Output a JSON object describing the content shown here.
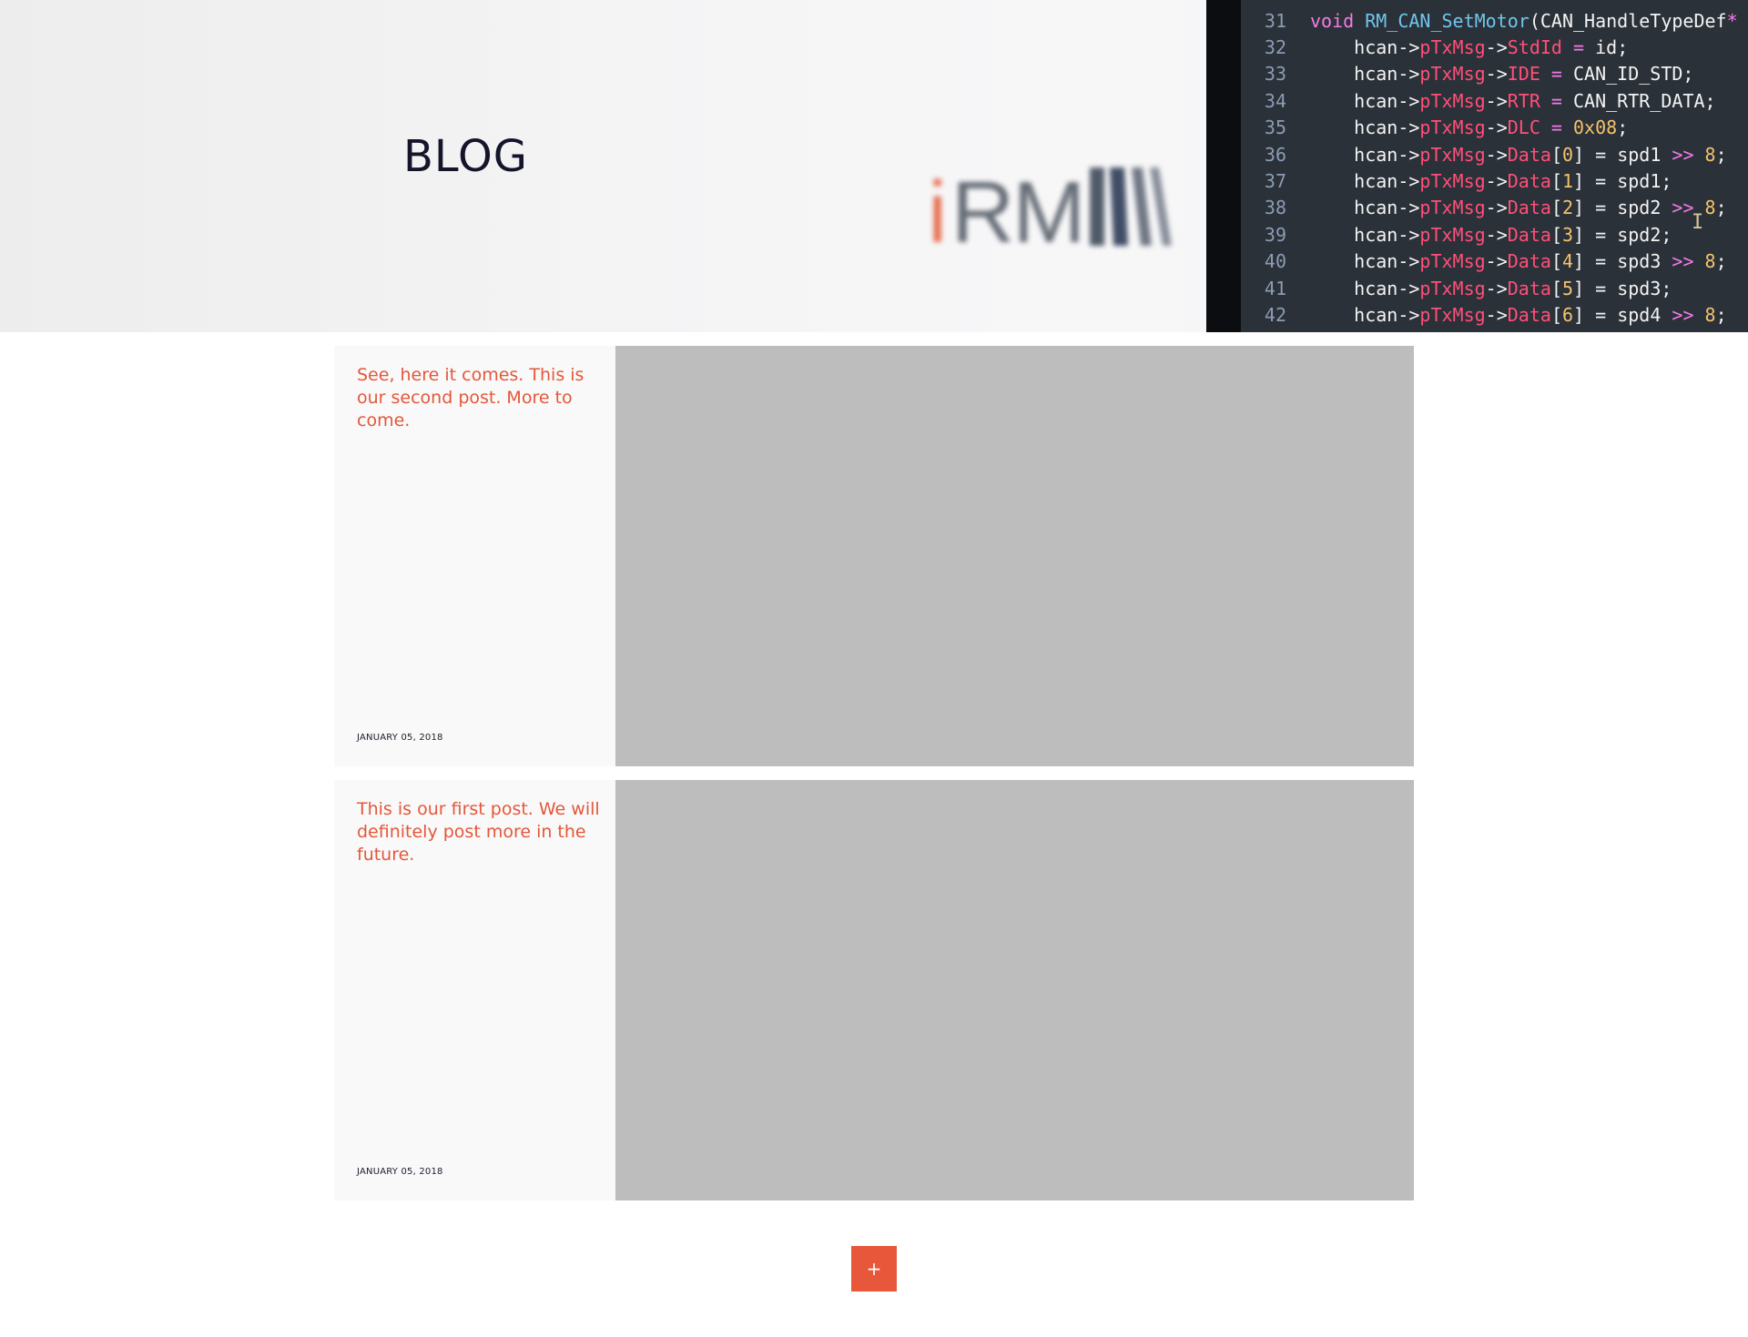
{
  "hero": {
    "title": "BLOG",
    "logo": {
      "i_text": "i",
      "rm_text": "RM",
      "bar_colors": [
        "#404a5a",
        "#2d3b57",
        "#626a78",
        "#7c8390"
      ]
    },
    "code": [
      {
        "n": "31",
        "tokens": [
          {
            "t": "void ",
            "c": "k"
          },
          {
            "t": "RM_CAN_SetMotor",
            "c": "fn"
          },
          {
            "t": "(CAN_HandleTypeDef",
            "c": ""
          },
          {
            "t": "*",
            "c": "k"
          }
        ]
      },
      {
        "n": "32",
        "tokens": [
          {
            "t": "    hcan->",
            "c": ""
          },
          {
            "t": "pTxMsg",
            "c": "pr"
          },
          {
            "t": "->",
            "c": ""
          },
          {
            "t": "StdId",
            "c": "pr"
          },
          {
            "t": " = ",
            "c": "op"
          },
          {
            "t": "id;",
            "c": ""
          }
        ]
      },
      {
        "n": "33",
        "tokens": [
          {
            "t": "    hcan->",
            "c": ""
          },
          {
            "t": "pTxMsg",
            "c": "pr"
          },
          {
            "t": "->",
            "c": ""
          },
          {
            "t": "IDE",
            "c": "pr"
          },
          {
            "t": " = ",
            "c": "op"
          },
          {
            "t": "CAN_ID_STD;",
            "c": ""
          }
        ]
      },
      {
        "n": "34",
        "tokens": [
          {
            "t": "    hcan->",
            "c": ""
          },
          {
            "t": "pTxMsg",
            "c": "pr"
          },
          {
            "t": "->",
            "c": ""
          },
          {
            "t": "RTR",
            "c": "pr"
          },
          {
            "t": " = ",
            "c": "op"
          },
          {
            "t": "CAN_RTR_DATA;",
            "c": ""
          }
        ]
      },
      {
        "n": "35",
        "tokens": [
          {
            "t": "    hcan->",
            "c": ""
          },
          {
            "t": "pTxMsg",
            "c": "pr"
          },
          {
            "t": "->",
            "c": ""
          },
          {
            "t": "DLC",
            "c": "pr"
          },
          {
            "t": " = ",
            "c": "op"
          },
          {
            "t": "0x08",
            "c": "nm"
          },
          {
            "t": ";",
            "c": ""
          }
        ]
      },
      {
        "n": "36",
        "tokens": [
          {
            "t": "    hcan->",
            "c": ""
          },
          {
            "t": "pTxMsg",
            "c": "pr"
          },
          {
            "t": "->",
            "c": ""
          },
          {
            "t": "Data",
            "c": "pr"
          },
          {
            "t": "[",
            "c": ""
          },
          {
            "t": "0",
            "c": "nm"
          },
          {
            "t": "] = spd1 ",
            "c": ""
          },
          {
            "t": ">>",
            "c": "op"
          },
          {
            "t": " 8",
            "c": "nm"
          },
          {
            "t": ";",
            "c": ""
          }
        ]
      },
      {
        "n": "37",
        "tokens": [
          {
            "t": "    hcan->",
            "c": ""
          },
          {
            "t": "pTxMsg",
            "c": "pr"
          },
          {
            "t": "->",
            "c": ""
          },
          {
            "t": "Data",
            "c": "pr"
          },
          {
            "t": "[",
            "c": ""
          },
          {
            "t": "1",
            "c": "nm"
          },
          {
            "t": "] = spd1;",
            "c": ""
          }
        ]
      },
      {
        "n": "38",
        "tokens": [
          {
            "t": "    hcan->",
            "c": ""
          },
          {
            "t": "pTxMsg",
            "c": "pr"
          },
          {
            "t": "->",
            "c": ""
          },
          {
            "t": "Data",
            "c": "pr"
          },
          {
            "t": "[",
            "c": ""
          },
          {
            "t": "2",
            "c": "nm"
          },
          {
            "t": "] = spd2 ",
            "c": ""
          },
          {
            "t": ">>",
            "c": "op"
          },
          {
            "t": " 8",
            "c": "nm"
          },
          {
            "t": ";",
            "c": ""
          }
        ]
      },
      {
        "n": "39",
        "tokens": [
          {
            "t": "    hcan->",
            "c": ""
          },
          {
            "t": "pTxMsg",
            "c": "pr"
          },
          {
            "t": "->",
            "c": ""
          },
          {
            "t": "Data",
            "c": "pr"
          },
          {
            "t": "[",
            "c": ""
          },
          {
            "t": "3",
            "c": "nm"
          },
          {
            "t": "] = spd2;",
            "c": ""
          }
        ]
      },
      {
        "n": "40",
        "tokens": [
          {
            "t": "    hcan->",
            "c": ""
          },
          {
            "t": "pTxMsg",
            "c": "pr"
          },
          {
            "t": "->",
            "c": ""
          },
          {
            "t": "Data",
            "c": "pr"
          },
          {
            "t": "[",
            "c": ""
          },
          {
            "t": "4",
            "c": "nm"
          },
          {
            "t": "] = spd3 ",
            "c": ""
          },
          {
            "t": ">>",
            "c": "op"
          },
          {
            "t": " 8",
            "c": "nm"
          },
          {
            "t": ";",
            "c": ""
          }
        ]
      },
      {
        "n": "41",
        "tokens": [
          {
            "t": "    hcan->",
            "c": ""
          },
          {
            "t": "pTxMsg",
            "c": "pr"
          },
          {
            "t": "->",
            "c": ""
          },
          {
            "t": "Data",
            "c": "pr"
          },
          {
            "t": "[",
            "c": ""
          },
          {
            "t": "5",
            "c": "nm"
          },
          {
            "t": "] = spd3;",
            "c": ""
          }
        ]
      },
      {
        "n": "42",
        "tokens": [
          {
            "t": "    hcan->",
            "c": ""
          },
          {
            "t": "pTxMsg",
            "c": "pr"
          },
          {
            "t": "->",
            "c": ""
          },
          {
            "t": "Data",
            "c": "pr"
          },
          {
            "t": "[",
            "c": ""
          },
          {
            "t": "6",
            "c": "nm"
          },
          {
            "t": "] = spd4 ",
            "c": ""
          },
          {
            "t": ">>",
            "c": "op"
          },
          {
            "t": " 8",
            "c": "nm"
          },
          {
            "t": ";",
            "c": ""
          }
        ]
      }
    ],
    "text_cursor_icon": "text-cursor-icon",
    "text_cursor_glyph": "I"
  },
  "posts": [
    {
      "title": "See, here it comes. This is our second post. More to come.",
      "date": "JANUARY 05, 2018",
      "image_color": "#bdbdbd"
    },
    {
      "title": "This is our first post. We will definitely post more in the future.",
      "date": "JANUARY 05, 2018",
      "image_color": "#bdbdbd"
    }
  ],
  "load_more": {
    "label": "+",
    "icon": "plus-icon",
    "color": "#e8573a"
  },
  "colors": {
    "accent": "#e4573a",
    "title": "#14142b",
    "card_bg": "#f9f9f9",
    "image_placeholder": "#bdbdbd"
  }
}
